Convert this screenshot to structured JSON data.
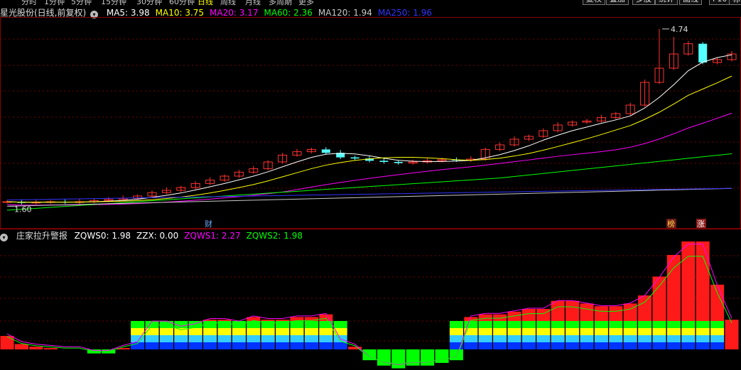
{
  "toolbar": {
    "periods": [
      "分时",
      "1分钟",
      "5分钟",
      "15分钟",
      "30分钟",
      "60分钟",
      "日线",
      "周线",
      "月线",
      "多周期",
      "更多"
    ],
    "active_period": "日线",
    "buttons": [
      "复权",
      "叠加",
      "多股",
      "统计",
      "画线",
      "F10",
      "标"
    ]
  },
  "main_chart": {
    "stock_name": "星光股份(日线,前复权)",
    "indicators": [
      {
        "label": "MA5: 3.98",
        "color": "#ffffff"
      },
      {
        "label": "MA10: 3.75",
        "color": "#ffff00"
      },
      {
        "label": "MA20: 3.17",
        "color": "#ff00ff"
      },
      {
        "label": "MA60: 2.36",
        "color": "#00ff00"
      },
      {
        "label": "MA120: 1.94",
        "color": "#c8c8c8"
      },
      {
        "label": "MA250: 1.96",
        "color": "#3333ff"
      }
    ],
    "high_label": "4.74",
    "low_label": "1.60",
    "markers": [
      {
        "label": "财",
        "color": "#6aaaff",
        "bg": "#000000"
      },
      {
        "label": "榜",
        "color": "#ffd54a",
        "bg": "#6a1a1a"
      },
      {
        "label": "涨",
        "color": "#ffffff",
        "bg": "#8a1a1a"
      }
    ]
  },
  "sub_chart": {
    "indicator_name": "庄家拉升警报",
    "values": [
      {
        "label": "ZQWS0: 1.98",
        "color": "#ffffff"
      },
      {
        "label": "ZZX: 0.00",
        "color": "#ffffff"
      },
      {
        "label": "ZQWS1: 2.27",
        "color": "#ff00ff"
      },
      {
        "label": "ZQWS2: 1.98",
        "color": "#00ff00"
      }
    ]
  },
  "chart_data": {
    "type": "candlestick",
    "candles": [
      [
        1.7,
        1.7,
        1.62,
        1.74
      ],
      [
        1.68,
        1.7,
        1.66,
        1.72
      ],
      [
        1.69,
        1.69,
        1.67,
        1.71
      ],
      [
        1.7,
        1.68,
        1.66,
        1.71
      ],
      [
        1.68,
        1.7,
        1.67,
        1.71
      ],
      [
        1.7,
        1.7,
        1.68,
        1.71
      ],
      [
        1.7,
        1.69,
        1.67,
        1.71
      ],
      [
        1.69,
        1.7,
        1.67,
        1.71
      ],
      [
        1.7,
        1.69,
        1.67,
        1.71
      ],
      [
        1.69,
        1.69,
        1.67,
        1.7
      ],
      [
        1.69,
        1.69,
        1.67,
        1.7
      ],
      [
        1.69,
        1.67,
        1.66,
        1.7
      ],
      [
        1.67,
        1.68,
        1.66,
        1.69
      ],
      [
        1.68,
        1.69,
        1.66,
        1.7
      ],
      [
        1.69,
        1.69,
        1.68,
        1.7
      ],
      [
        1.69,
        1.69,
        1.68,
        1.7
      ],
      [
        1.69,
        1.68,
        1.67,
        1.7
      ],
      [
        1.68,
        1.7,
        1.67,
        1.71
      ],
      [
        1.7,
        1.7,
        1.69,
        1.71
      ],
      [
        1.7,
        1.7,
        1.69,
        1.71
      ],
      [
        1.7,
        1.72,
        1.69,
        1.73
      ],
      [
        1.72,
        1.73,
        1.71,
        1.74
      ],
      [
        1.73,
        1.72,
        1.71,
        1.74
      ],
      [
        1.72,
        1.74,
        1.71,
        1.75
      ],
      [
        1.74,
        1.76,
        1.73,
        1.77
      ],
      [
        1.76,
        1.76,
        1.75,
        1.77
      ],
      [
        1.76,
        1.78,
        1.75,
        1.79
      ],
      [
        1.78,
        1.79,
        1.77,
        1.8
      ],
      [
        1.79,
        1.8,
        1.78,
        1.81
      ],
      [
        1.8,
        1.81,
        1.79,
        1.82
      ],
      [
        1.81,
        1.83,
        1.8,
        1.84
      ],
      [
        1.83,
        1.82,
        1.81,
        1.84
      ],
      [
        1.82,
        1.84,
        1.81,
        1.85
      ],
      [
        1.84,
        1.86,
        1.82,
        1.87
      ],
      [
        1.86,
        1.88,
        1.85,
        1.89
      ],
      [
        1.88,
        1.9,
        1.87,
        1.91
      ],
      [
        1.9,
        1.92,
        1.89,
        1.93
      ],
      [
        1.92,
        1.94,
        1.91,
        1.95
      ],
      [
        1.94,
        1.95,
        1.93,
        1.96
      ],
      [
        1.95,
        1.96,
        1.94,
        1.97
      ],
      [
        1.96,
        1.97,
        1.95,
        1.98
      ],
      [
        1.97,
        1.98,
        1.96,
        1.99
      ],
      [
        1.98,
        2.0,
        1.97,
        2.01
      ],
      [
        2.0,
        2.01,
        1.99,
        2.02
      ],
      [
        2.01,
        2.02,
        2.0,
        2.03
      ]
    ],
    "price_range": [
      1.5,
      4.9
    ],
    "ma_series": [
      "MA5",
      "MA10",
      "MA20",
      "MA60",
      "MA120",
      "MA250"
    ],
    "sub_range": [
      -1,
      4
    ]
  }
}
